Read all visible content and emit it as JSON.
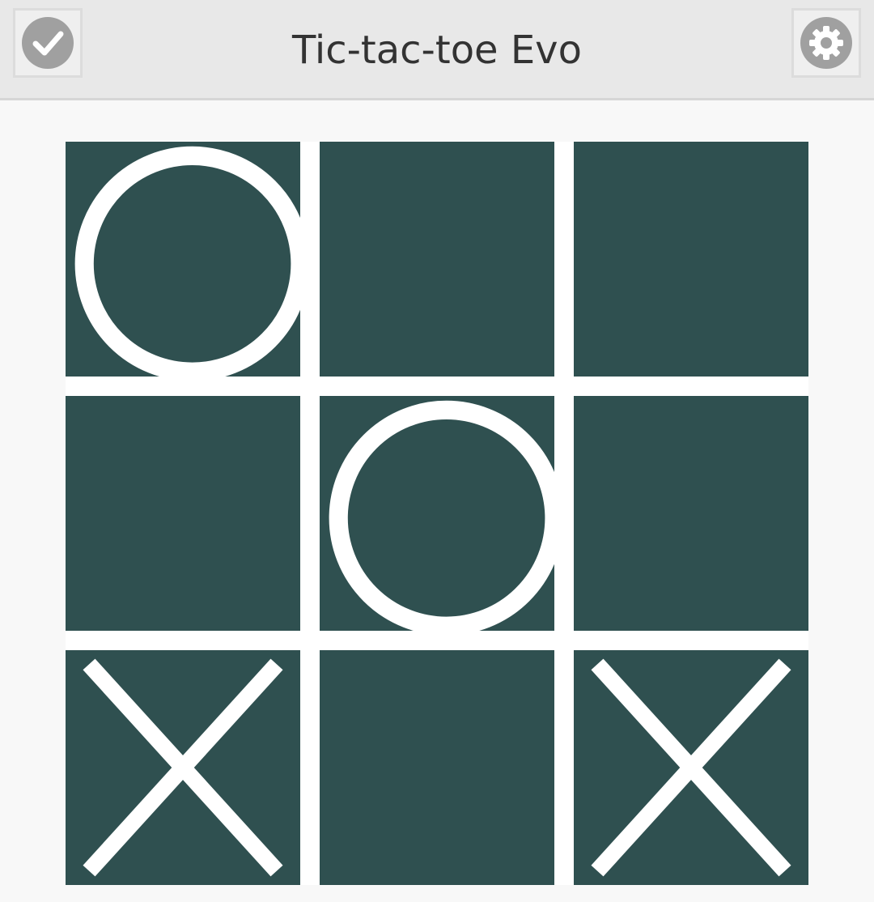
{
  "header": {
    "title": "Tic-tac-toe Evo",
    "left_icon": "checkmark-icon",
    "right_icon": "gear-icon"
  },
  "colors": {
    "header_bg": "#e8e8e8",
    "page_bg": "#f8f8f8",
    "cell_bg": "#2f5050",
    "mark": "#ffffff",
    "icon": "#a0a0a0"
  },
  "board": {
    "rows": 3,
    "cols": 3,
    "cells": [
      [
        "O",
        "",
        ""
      ],
      [
        "",
        "O",
        ""
      ],
      [
        "X",
        "",
        "X"
      ]
    ]
  }
}
